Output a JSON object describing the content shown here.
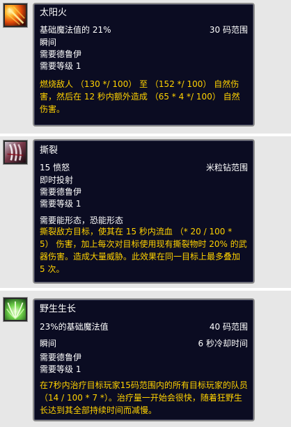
{
  "spells": [
    {
      "name": "太阳火",
      "cost": "基础魔法值的 21%",
      "range": "30 码范围",
      "cast": "瞬间",
      "requires_class": "需要德鲁伊",
      "requires_level": "需要等级 1",
      "description": "燃烧敌人 （130 */ 100） 至 （152 */ 100） 自然伤害，然后在 12 秒内额外造成 （65 * 4 */ 100） 自然伤害。",
      "icon": "sunfire-icon"
    },
    {
      "name": "撕裂",
      "cost": "15 愤怒",
      "range": "米粒钻范围",
      "cast": "即时投射",
      "requires_class": "需要德鲁伊",
      "requires_level": "需要等级 1",
      "requires_form": "需要能形态，恐能形态",
      "description": "撕裂敌方目标，使其在 15 秒内流血 （* 20 / 100 * 5） 伤害，加上每次对目标使用现有撕裂物时 20% 的武器伤害。造成大量威胁。此效果在同一目标上最多叠加 5 次。",
      "icon": "lacerate-icon"
    },
    {
      "name": "野生生长",
      "cost": "23%的基础魔法值",
      "range": "40 码范围",
      "cast": "瞬间",
      "cooldown": "6 秒冷却时间",
      "requires_class": "需要德鲁伊",
      "requires_level": "需要等级 1",
      "description": "在7秒内治疗目标玩家15码范围内的所有目标玩家的队员 （14 / 100 * 7 *）。治疗量一开始会很快，随着狂野生长达到其全部持续时间而减慢。",
      "icon": "wild-growth-icon"
    }
  ],
  "colors": {
    "tooltip_bg": "#0b0c22",
    "tooltip_border": "#8d8d8d",
    "text_white": "#ffffff",
    "text_gold": "#ffd200",
    "panel_bg": "#e7e7e7"
  }
}
